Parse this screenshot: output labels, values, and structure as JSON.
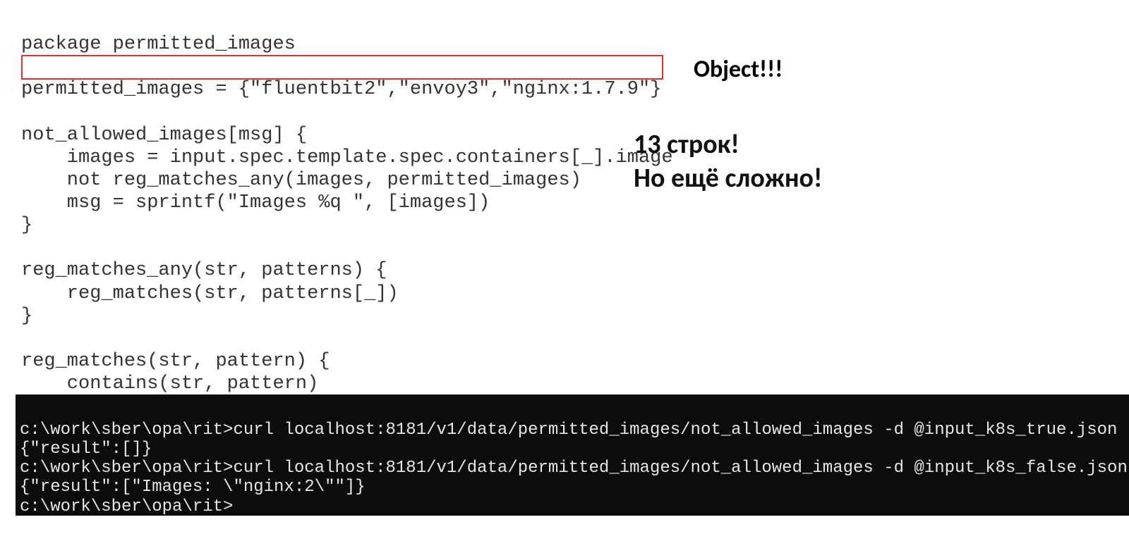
{
  "code": {
    "l01": "package permitted_images",
    "l02": "",
    "l03": "permitted_images = {\"fluentbit2\",\"envoy3\",\"nginx:1.7.9\"}",
    "l04": "",
    "l05": "not_allowed_images[msg] {",
    "l06": "    images = input.spec.template.spec.containers[_].image",
    "l07": "    not reg_matches_any(images, permitted_images)",
    "l08": "    msg = sprintf(\"Images %q \", [images])",
    "l09": "}",
    "l10": "",
    "l11": "reg_matches_any(str, patterns) {",
    "l12": "    reg_matches(str, patterns[_])",
    "l13": "}",
    "l14": "",
    "l15": "reg_matches(str, pattern) {",
    "l16": "    contains(str, pattern)",
    "l17": "}"
  },
  "annotations": {
    "object": "Object!!!",
    "right_line1": "13 строк!",
    "right_line2": "Но ещё сложно!"
  },
  "terminal": {
    "l1": "c:\\work\\sber\\opa\\rit>curl localhost:8181/v1/data/permitted_images/not_allowed_images -d @input_k8s_true.json",
    "l2": "{\"result\":[]}",
    "l3": "c:\\work\\sber\\opa\\rit>curl localhost:8181/v1/data/permitted_images/not_allowed_images -d @input_k8s_false.json",
    "l4": "{\"result\":[\"Images: \\\"nginx:2\\\"\"]}",
    "l5": "c:\\work\\sber\\opa\\rit>"
  }
}
